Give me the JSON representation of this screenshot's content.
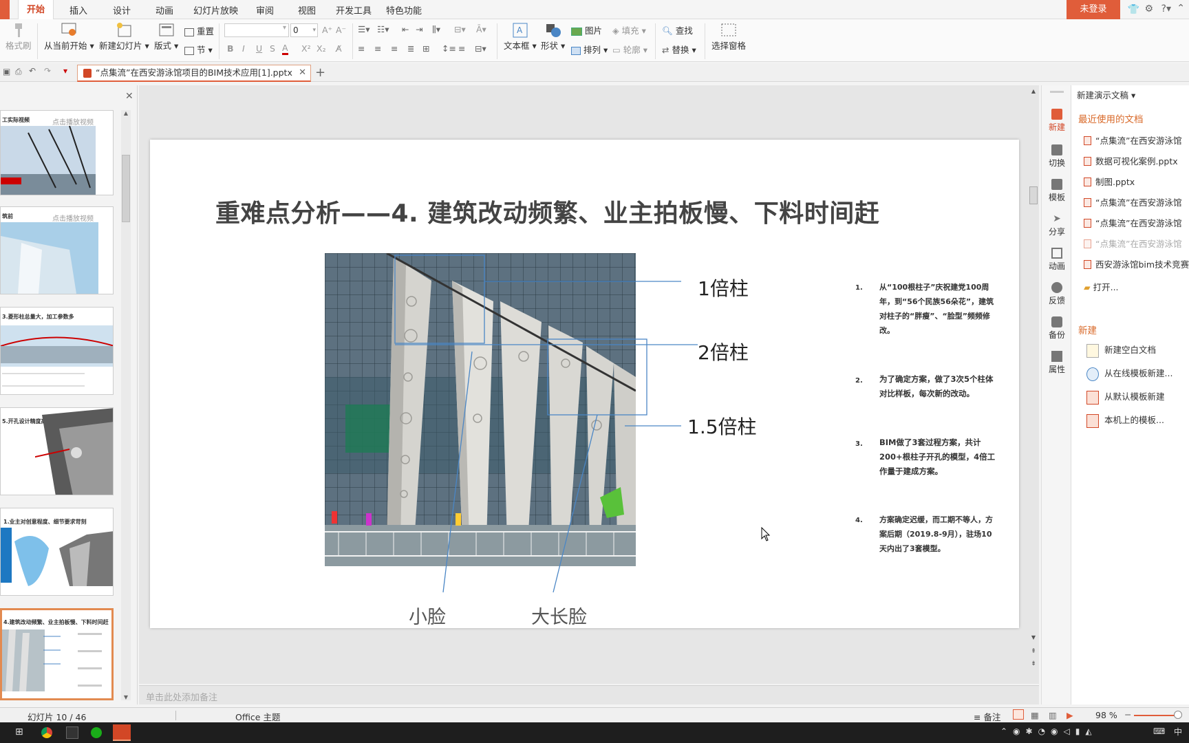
{
  "menu": {
    "tabs": [
      "开始",
      "插入",
      "设计",
      "动画",
      "幻灯片放映",
      "审阅",
      "视图",
      "开发工具",
      "特色功能"
    ],
    "login": "未登录"
  },
  "ribbon": {
    "format_painter": "格式刷",
    "from_current": "从当前开始",
    "new_slide": "新建幻灯片",
    "layout": "版式",
    "reset": "重置",
    "section": "节",
    "font_size": "0",
    "text_box": "文本框",
    "shape": "形状",
    "picture": "图片",
    "arrange": "排列",
    "fill": "填充",
    "outline": "轮廓",
    "find": "查找",
    "replace": "替换",
    "selection_pane": "选择窗格"
  },
  "doc_tab": {
    "title": "“点集流”在西安游泳馆项目的BIM技术应用[1].pptx"
  },
  "thumbnails": {
    "t1_title": "工实际视频",
    "t1_play": "点击播放视频",
    "t2_title": "筑前",
    "t2_play": "点击播放视频",
    "t3_title": "3.菱形柱总量大，加工参数多",
    "t4_title": "5.开孔设计精度高",
    "t5_title": "1.业主对创意程度、细节要求苛刻",
    "t6_title": "4.建筑改动频繁、业主拍板慢、下料时间赶"
  },
  "slide": {
    "title": "重难点分析——4. 建筑改动频繁、业主拍板慢、下料时间赶",
    "labels": {
      "col1": "1倍柱",
      "col2": "2倍柱",
      "col15": "1.5倍柱",
      "small_face": "小脸",
      "long_face": "大长脸"
    },
    "notes": [
      {
        "num": "1.",
        "text": "从“100根柱子”庆祝建党100周年，到“56个民族56朵花”，建筑对柱子的“胖瘦”、“脸型”频频修改。"
      },
      {
        "num": "2.",
        "text": "为了确定方案，做了3次5个柱体对比样板，每次新的改动。"
      },
      {
        "num": "3.",
        "text": "BIM做了3套过程方案，共计200+根柱子开孔的模型，4倍工作量于建成方案。"
      },
      {
        "num": "4.",
        "text": "方案确定迟缓，而工期不等人，方案后期（2019.8-9月），驻场10天内出了3套模型。"
      }
    ]
  },
  "notes_placeholder": "单击此处添加备注",
  "side_buttons": [
    "新建",
    "切换",
    "模板",
    "分享",
    "动画",
    "反馈",
    "备份",
    "属性"
  ],
  "right_panel": {
    "header": "新建演示文稿",
    "recent_title": "最近使用的文档",
    "recent": [
      "“点集流”在西安游泳馆",
      "数据可视化案例.pptx",
      "制图.pptx",
      "“点集流”在西安游泳馆",
      "“点集流”在西安游泳馆",
      "“点集流”在西安游泳馆",
      "西安游泳馆bim技术竞赛"
    ],
    "open": "打开...",
    "new_title": "新建",
    "new_items": [
      "新建空白文档",
      "从在线模板新建...",
      "从默认模板新建",
      "本机上的模板..."
    ]
  },
  "status": {
    "slide_info": "幻灯片 10 / 46",
    "theme": "Office 主题",
    "notes_btn": "备注",
    "zoom": "98 %"
  },
  "colors": {
    "accent": "#e05d3a",
    "slide_line": "#4a86c5"
  }
}
